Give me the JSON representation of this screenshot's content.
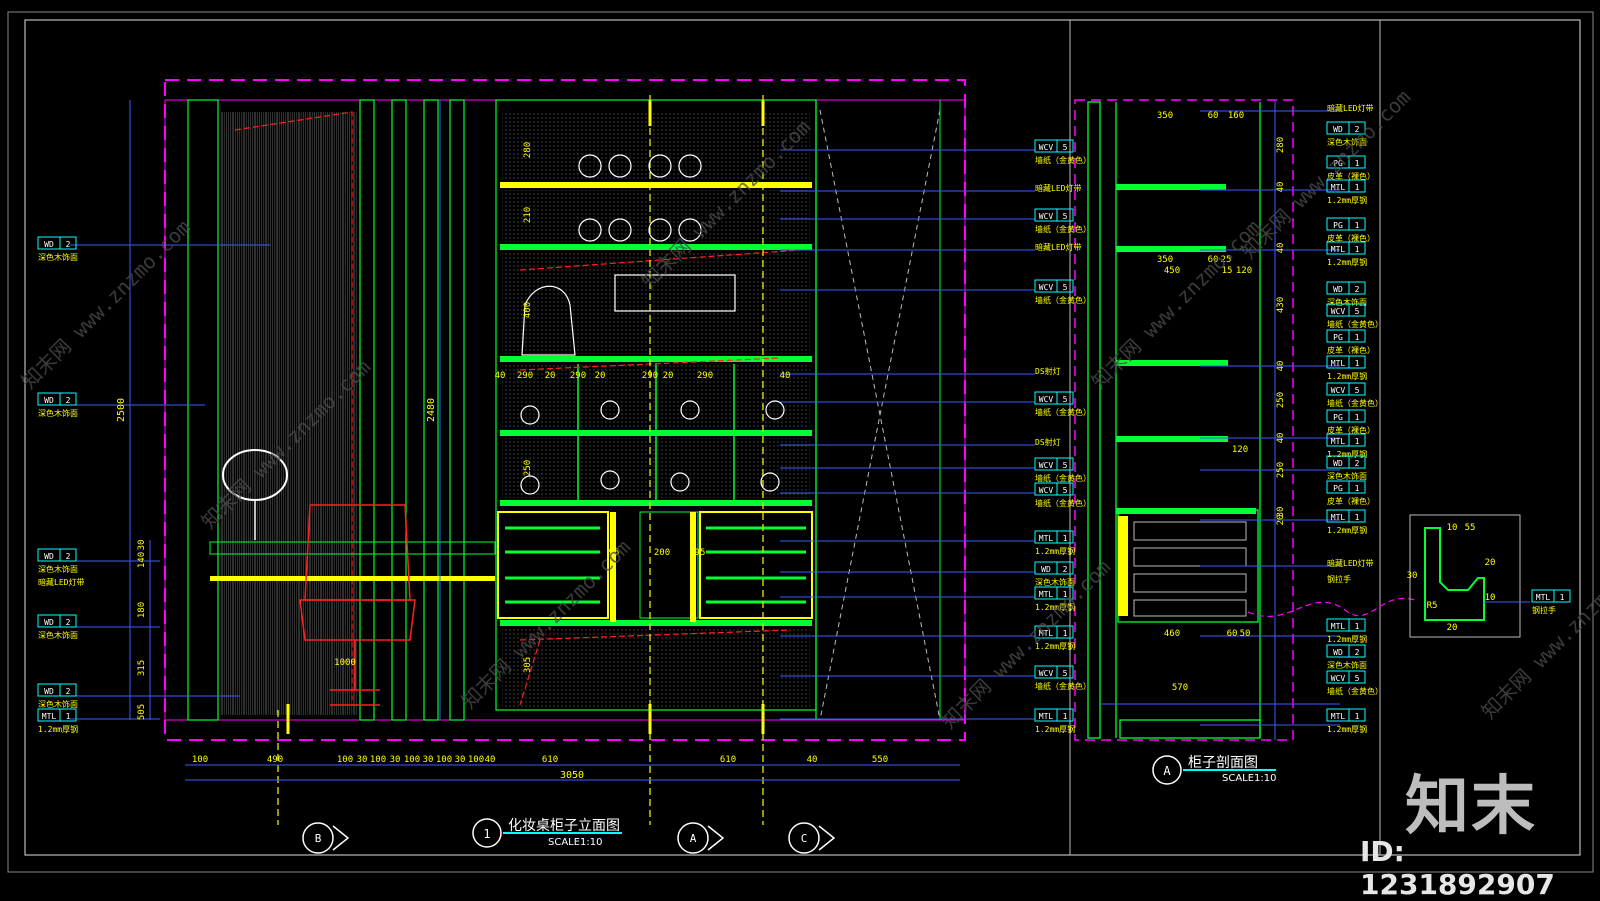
{
  "elevation": {
    "title": "化妆桌柜子立面图",
    "number": "1",
    "scale": "SCALE1:10",
    "section_marks": [
      "B",
      "A",
      "C"
    ],
    "overall_dim": "3050",
    "height_dims": [
      "2500",
      "2480"
    ],
    "bottom_dims": [
      "100",
      "490",
      "100",
      "30",
      "100",
      "30",
      "100",
      "30",
      "100",
      "30",
      "100",
      "40",
      "610",
      "610",
      "40",
      "550"
    ],
    "left_vertical_dims": [
      "505",
      "315",
      "180",
      "140",
      "30"
    ],
    "shelf_dims": [
      "280",
      "210",
      "400",
      "40",
      "290",
      "20",
      "290",
      "20",
      "290",
      "20",
      "290",
      "40",
      "250",
      "305",
      "95",
      "200",
      "95",
      "1000"
    ]
  },
  "left_tags": [
    {
      "code": "WD",
      "num": "2",
      "note": "深色木饰面"
    },
    {
      "code": "WD",
      "num": "2",
      "note": "深色木饰面"
    },
    {
      "code": "WD",
      "num": "2",
      "note": "深色木饰面",
      "extra": "暗藏LED灯带"
    },
    {
      "code": "WD",
      "num": "2",
      "note": "深色木饰面"
    },
    {
      "code": "WD",
      "num": "2",
      "note": "深色木饰面"
    },
    {
      "code": "MTL",
      "num": "1",
      "note": "1.2mm厚钢"
    }
  ],
  "right_tags": [
    {
      "code": "WCV",
      "num": "5",
      "note": "墙纸（金黄色）"
    },
    {
      "code": "",
      "num": "",
      "note": "暗藏LED灯带"
    },
    {
      "code": "WCV",
      "num": "5",
      "note": "墙纸（金黄色）"
    },
    {
      "code": "",
      "num": "",
      "note": "暗藏LED灯带"
    },
    {
      "code": "WCV",
      "num": "5",
      "note": "墙纸（金黄色）"
    },
    {
      "code": "",
      "num": "",
      "note": "DS射灯"
    },
    {
      "code": "WCV",
      "num": "5",
      "note": "墙纸（金黄色）"
    },
    {
      "code": "",
      "num": "",
      "note": "DS射灯"
    },
    {
      "code": "WCV",
      "num": "5",
      "note": "墙纸（金黄色）"
    },
    {
      "code": "WCV",
      "num": "5",
      "note": "墙纸（金黄色）"
    },
    {
      "code": "MTL",
      "num": "1",
      "note": "1.2mm厚钢"
    },
    {
      "code": "WD",
      "num": "2",
      "note": "深色木饰面"
    },
    {
      "code": "MTL",
      "num": "1",
      "note": "1.2mm厚钢"
    },
    {
      "code": "MTL",
      "num": "1",
      "note": "1.2mm厚钢"
    },
    {
      "code": "WCV",
      "num": "5",
      "note": "墙纸（金黄色）"
    },
    {
      "code": "MTL",
      "num": "1",
      "note": "1.2mm厚钢"
    }
  ],
  "section": {
    "title": "柜子剖面图",
    "mark": "A",
    "scale": "SCALE1:10",
    "dims": [
      "350",
      "60",
      "160",
      "350",
      "450",
      "60",
      "25",
      "15",
      "120",
      "120",
      "460",
      "60",
      "50",
      "570"
    ],
    "vertical_dims": [
      "280",
      "40",
      "40",
      "430",
      "40",
      "250",
      "40",
      "250",
      "30",
      "20"
    ],
    "tags": [
      {
        "code": "",
        "num": "",
        "note": "暗藏LED灯带"
      },
      {
        "code": "WD",
        "num": "2",
        "note": "深色木饰面"
      },
      {
        "code": "PG",
        "num": "1",
        "note": "皮革（裸色）"
      },
      {
        "code": "MTL",
        "num": "1",
        "note": "1.2mm厚钢"
      },
      {
        "code": "PG",
        "num": "1",
        "note": "皮革（裸色）"
      },
      {
        "code": "MTL",
        "num": "1",
        "note": "1.2mm厚钢"
      },
      {
        "code": "WD",
        "num": "2",
        "note": "深色木饰面"
      },
      {
        "code": "WCV",
        "num": "5",
        "note": "墙纸（金黄色）"
      },
      {
        "code": "PG",
        "num": "1",
        "note": "皮革（裸色）"
      },
      {
        "code": "MTL",
        "num": "1",
        "note": "1.2mm厚钢"
      },
      {
        "code": "WCV",
        "num": "5",
        "note": "墙纸（金黄色）"
      },
      {
        "code": "PG",
        "num": "1",
        "note": "皮革（裸色）"
      },
      {
        "code": "MTL",
        "num": "1",
        "note": "1.2mm厚钢"
      },
      {
        "code": "WD",
        "num": "2",
        "note": "深色木饰面"
      },
      {
        "code": "PG",
        "num": "1",
        "note": "皮革（裸色）"
      },
      {
        "code": "MTL",
        "num": "1",
        "note": "1.2mm厚钢"
      },
      {
        "code": "",
        "num": "",
        "note": "暗藏LED灯带"
      },
      {
        "code": "",
        "num": "",
        "note": "钢拉手"
      },
      {
        "code": "MTL",
        "num": "1",
        "note": "1.2mm厚钢"
      },
      {
        "code": "WD",
        "num": "2",
        "note": "深色木饰面"
      },
      {
        "code": "WCV",
        "num": "5",
        "note": "墙纸（金黄色）"
      },
      {
        "code": "MTL",
        "num": "1",
        "note": "1.2mm厚钢"
      }
    ]
  },
  "detail": {
    "dims": [
      "10",
      "55",
      "30",
      "20",
      "10",
      "20",
      "R5"
    ],
    "tag": {
      "code": "MTL",
      "num": "1",
      "note": "钢拉手"
    }
  },
  "watermark": {
    "brand": "知末",
    "id": "ID: 1231892907",
    "diag": [
      "知末网 www.znzmo.com"
    ]
  },
  "colors": {
    "bg": "#000000",
    "frame": "#9a9a9a",
    "magenta": "#ff00ff",
    "green": "#00ff33",
    "yellow": "#ffff00",
    "cyan": "#00ffff",
    "blue": "#3b5bff",
    "red": "#ff2020",
    "white": "#ffffff",
    "gray": "#7a7a7a"
  }
}
